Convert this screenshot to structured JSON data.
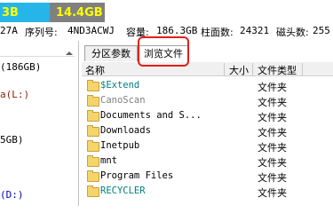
{
  "disk_bar": {
    "left_label": "3B",
    "right_label": "14.4GB"
  },
  "info_bar": {
    "prefix": "27A",
    "serial_label": "序列号:",
    "serial": "4ND3ACWJ",
    "capacity_label": "容量:",
    "capacity": "186.3GB",
    "cylinders_label": "柱面数:",
    "cylinders": "24321",
    "heads_label": "磁头数:",
    "heads": "255"
  },
  "left_pane": {
    "items": [
      {
        "text": "(186GB)",
        "color": "#000000"
      },
      {
        "text": "a(L:)",
        "color": "#8b2000"
      },
      {
        "text": "5GB)",
        "color": "#000000"
      },
      {
        "text": "(D:)",
        "color": "#0000c0"
      }
    ]
  },
  "tabs": [
    {
      "label": "分区参数",
      "active": false
    },
    {
      "label": "浏览文件",
      "active": true
    }
  ],
  "columns": {
    "name": "名称",
    "size": "大小",
    "type": "文件类型"
  },
  "files": [
    {
      "name": "$Extend",
      "type": "文件夹",
      "color": "#008080"
    },
    {
      "name": "CanoScan",
      "type": "文件夹",
      "color": "#808080"
    },
    {
      "name": "Documents and S...",
      "type": "文件夹",
      "color": "#000000"
    },
    {
      "name": "Downloads",
      "type": "文件夹",
      "color": "#000000"
    },
    {
      "name": "Inetpub",
      "type": "文件夹",
      "color": "#000000"
    },
    {
      "name": "mnt",
      "type": "文件夹",
      "color": "#000000"
    },
    {
      "name": "Program Files",
      "type": "文件夹",
      "color": "#000000"
    },
    {
      "name": "RECYCLER",
      "type": "文件夹",
      "color": "#008080"
    }
  ]
}
